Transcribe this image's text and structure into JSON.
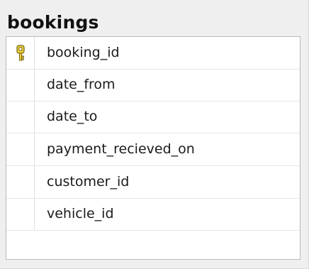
{
  "table": {
    "title": "bookings",
    "columns": [
      {
        "name": "booking_id",
        "primary_key": true,
        "icon": "key-icon"
      },
      {
        "name": "date_from",
        "primary_key": false
      },
      {
        "name": "date_to",
        "primary_key": false
      },
      {
        "name": "payment_recieved_on",
        "primary_key": false
      },
      {
        "name": "customer_id",
        "primary_key": false
      },
      {
        "name": "vehicle_id",
        "primary_key": false
      }
    ]
  },
  "colors": {
    "key_fill": "#f2d33a",
    "key_stroke": "#7a6a1a"
  }
}
